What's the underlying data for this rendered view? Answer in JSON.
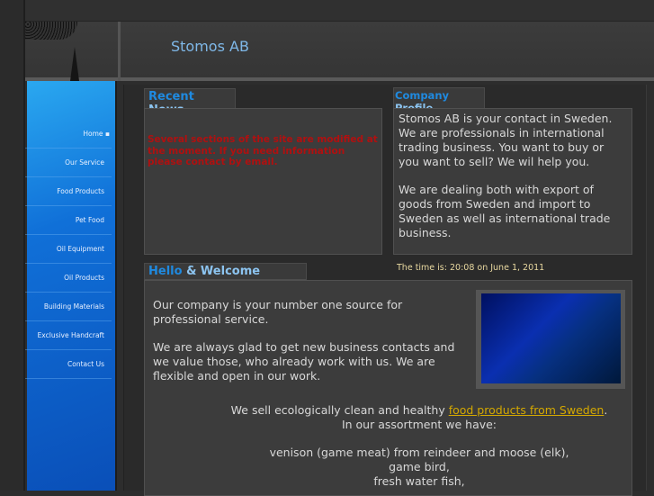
{
  "site": {
    "title": "Stomos AB"
  },
  "menu": [
    "Home",
    "Our Service",
    "Food Products",
    "Pet Food",
    "Oil Equipment",
    "Oil Products",
    "Building Materials",
    "Exclusive Handcraft",
    "Contact Us"
  ],
  "news": {
    "tab_a": "Recent",
    "tab_b": " News",
    "text": "Several sections of the site are modified at the moment. If you need information please contact by email."
  },
  "profile": {
    "tab_a": "Company",
    "tab_b": " Profile",
    "p1": "Stomos AB is your contact in Sweden. We are professionals in international trading business. You want to buy or you want to sell? We wil help you.",
    "p2": "We are dealing both with export of goods from Sweden and import to Sweden as well as international trade business."
  },
  "time": "The time is: 20:08 on June 1, 2011",
  "welcome": {
    "tab_a": "Hello",
    "tab_b": " & Welcome",
    "p1": "Our company is your number one source for professional service.",
    "p2": "We are always glad to get new business contacts and we value those, who already work with us. We are flexible and open in our work.",
    "sell_pre": "We sell ecologically clean and healthy ",
    "sell_link": "food products from Sweden",
    "sell_post": ".",
    "assort": "In our assortment we have:",
    "items": [
      "venison (game meat) from reindeer and moose (elk),",
      "game bird,",
      "fresh water fish,"
    ]
  }
}
